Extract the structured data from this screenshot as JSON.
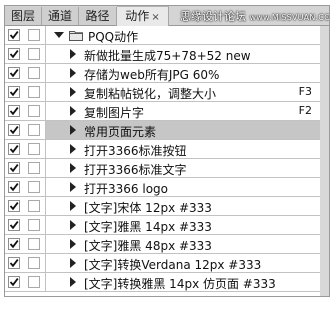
{
  "tabs": [
    {
      "label": "图层",
      "active": false
    },
    {
      "label": "通道",
      "active": false
    },
    {
      "label": "路径",
      "active": false
    },
    {
      "label": "动作",
      "active": true,
      "close": "×"
    }
  ],
  "watermark": {
    "text": "思缘设计论坛",
    "url": "www.MISSVUAN.COM"
  },
  "action_set": {
    "name": "PQQ动作",
    "expanded": true,
    "checked": true
  },
  "actions": [
    {
      "label": "新做批量生成75+78+52 new",
      "shortcut": "",
      "checked": true,
      "selected": false
    },
    {
      "label": "存储为web所有JPG 60%",
      "shortcut": "",
      "checked": true,
      "selected": false
    },
    {
      "label": "复制粘帖锐化，调整大小",
      "shortcut": "F3",
      "checked": true,
      "selected": false
    },
    {
      "label": "复制图片字",
      "shortcut": "F2",
      "checked": true,
      "selected": false
    },
    {
      "label": "常用页面元素",
      "shortcut": "",
      "checked": true,
      "selected": true
    },
    {
      "label": "打开3366标准按钮",
      "shortcut": "",
      "checked": true,
      "selected": false
    },
    {
      "label": "打开3366标准文字",
      "shortcut": "",
      "checked": true,
      "selected": false
    },
    {
      "label": "打开3366 logo",
      "shortcut": "",
      "checked": true,
      "selected": false
    },
    {
      "label": "[文字]宋体 12px #333",
      "shortcut": "",
      "checked": true,
      "selected": false
    },
    {
      "label": "[文字]雅黑 14px #333",
      "shortcut": "",
      "checked": true,
      "selected": false
    },
    {
      "label": "[文字]雅黑 48px #333",
      "shortcut": "",
      "checked": true,
      "selected": false
    },
    {
      "label": "[文字]转换Verdana 12px #333",
      "shortcut": "",
      "checked": true,
      "selected": false
    },
    {
      "label": "[文字]转换雅黑 14px 仿页面 #333",
      "shortcut": "",
      "checked": true,
      "selected": false
    }
  ],
  "colors": {
    "panel_bg": "#d4d4d4",
    "list_bg": "#ffffff",
    "selected_bg": "#c6c6c6",
    "border": "#9a9a9a"
  }
}
